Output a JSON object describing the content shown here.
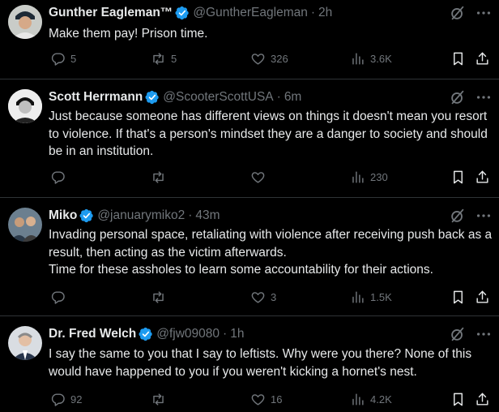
{
  "tweets": [
    {
      "name": "Gunther Eagleman™",
      "handle": "@GuntherEagleman",
      "time": "2h",
      "body": [
        "Make them pay!  Prison time."
      ],
      "replies": "5",
      "reposts": "5",
      "likes": "326",
      "views": "3.6K"
    },
    {
      "name": "Scott Herrmann",
      "handle": "@ScooterScottUSA",
      "time": "6m",
      "body": [
        "Just because someone has different views on things it doesn't mean you resort to violence. If that's a person's mindset they are a danger to society and should be in an institution."
      ],
      "replies": "",
      "reposts": "",
      "likes": "",
      "views": "230"
    },
    {
      "name": "Miko",
      "handle": "@januarymiko2",
      "time": "43m",
      "body": [
        "Invading personal space, retaliating with violence after receiving push back as a result, then acting as the victim afterwards.",
        "Time for these assholes to learn some accountability for their actions."
      ],
      "replies": "",
      "reposts": "",
      "likes": "3",
      "views": "1.5K"
    },
    {
      "name": "Dr. Fred Welch",
      "handle": "@fjw09080",
      "time": "1h",
      "body": [
        "I say the same to you that I say to leftists. Why were you there? None of this would have happened to you if you weren't kicking a hornet's nest."
      ],
      "replies": "92",
      "reposts": "",
      "likes": "16",
      "views": "4.2K"
    }
  ],
  "icons": {
    "verified": "verified-badge-icon",
    "grok": "grok-slash-icon",
    "more": "more-dots-icon",
    "reply": "reply-icon",
    "repost": "repost-icon",
    "like": "like-icon",
    "views": "views-icon",
    "bookmark": "bookmark-icon",
    "share": "share-icon"
  },
  "colors": {
    "background": "#000000",
    "text": "#e7e9ea",
    "muted": "#71767b",
    "verified": "#1d9bf0",
    "divider": "#2f3336"
  }
}
